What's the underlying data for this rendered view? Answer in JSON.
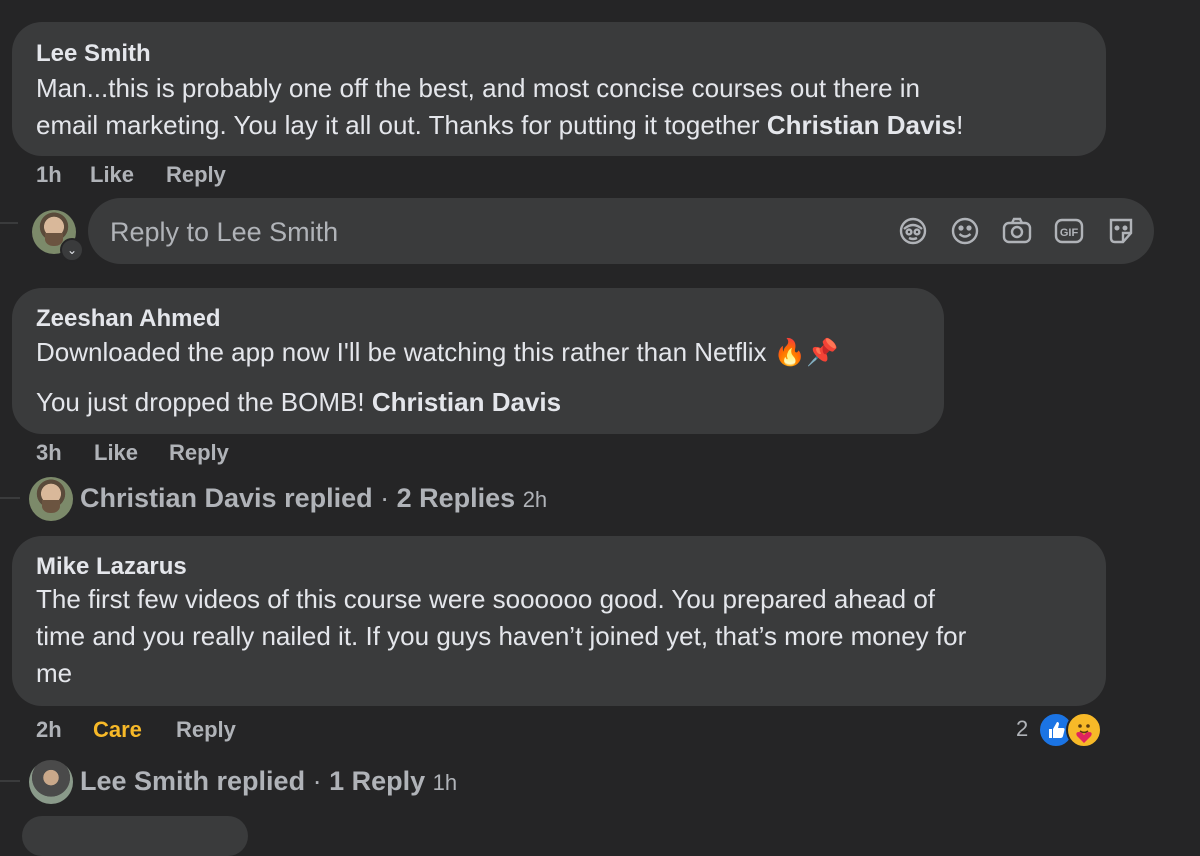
{
  "comments": [
    {
      "author": "Lee Smith",
      "text_lines": [
        "Man...this is probably one off the best, and most concise courses out there in",
        "email marketing. You lay it all out. Thanks for putting it together "
      ],
      "mention": "Christian Davis",
      "after_mention": "!",
      "time": "1h",
      "like_label": "Like",
      "reply_label": "Reply"
    },
    {
      "author": "Zeeshan Ahmed",
      "line1": "Downloaded the app now I'll be watching this rather than Netflix 🔥📌",
      "line2": "You just dropped the BOMB! ",
      "mention": "Christian Davis",
      "time": "3h",
      "like_label": "Like",
      "reply_label": "Reply",
      "replies_summary": {
        "name_replied": "Christian Davis replied",
        "separator": " · ",
        "count": "2 Replies",
        "time": "2h"
      }
    },
    {
      "author": "Mike Lazarus",
      "text_lines": [
        "The first few videos of this course were soooooo good. You prepared ahead of",
        "time and you really nailed it. If you guys haven’t joined yet, that’s more money for",
        "me"
      ],
      "time": "2h",
      "reaction_label": "Care",
      "reply_label": "Reply",
      "reaction_count": "2",
      "reaction_icons": [
        "like-icon",
        "care-icon"
      ],
      "replies_summary": {
        "name_replied": "Lee Smith replied",
        "separator": " · ",
        "count": "1 Reply",
        "time": "1h"
      }
    }
  ],
  "reply_box": {
    "placeholder": "Reply to Lee Smith",
    "tools": [
      "avatar-sticker-icon",
      "emoji-icon",
      "camera-icon",
      "gif-icon",
      "sticker-icon"
    ]
  },
  "colors": {
    "background": "#252526",
    "bubble": "#3a3b3c",
    "text": "#e4e6eb",
    "secondary_text": "#b0b3b8",
    "care": "#f7b928",
    "like_blue": "#1b74e4"
  }
}
